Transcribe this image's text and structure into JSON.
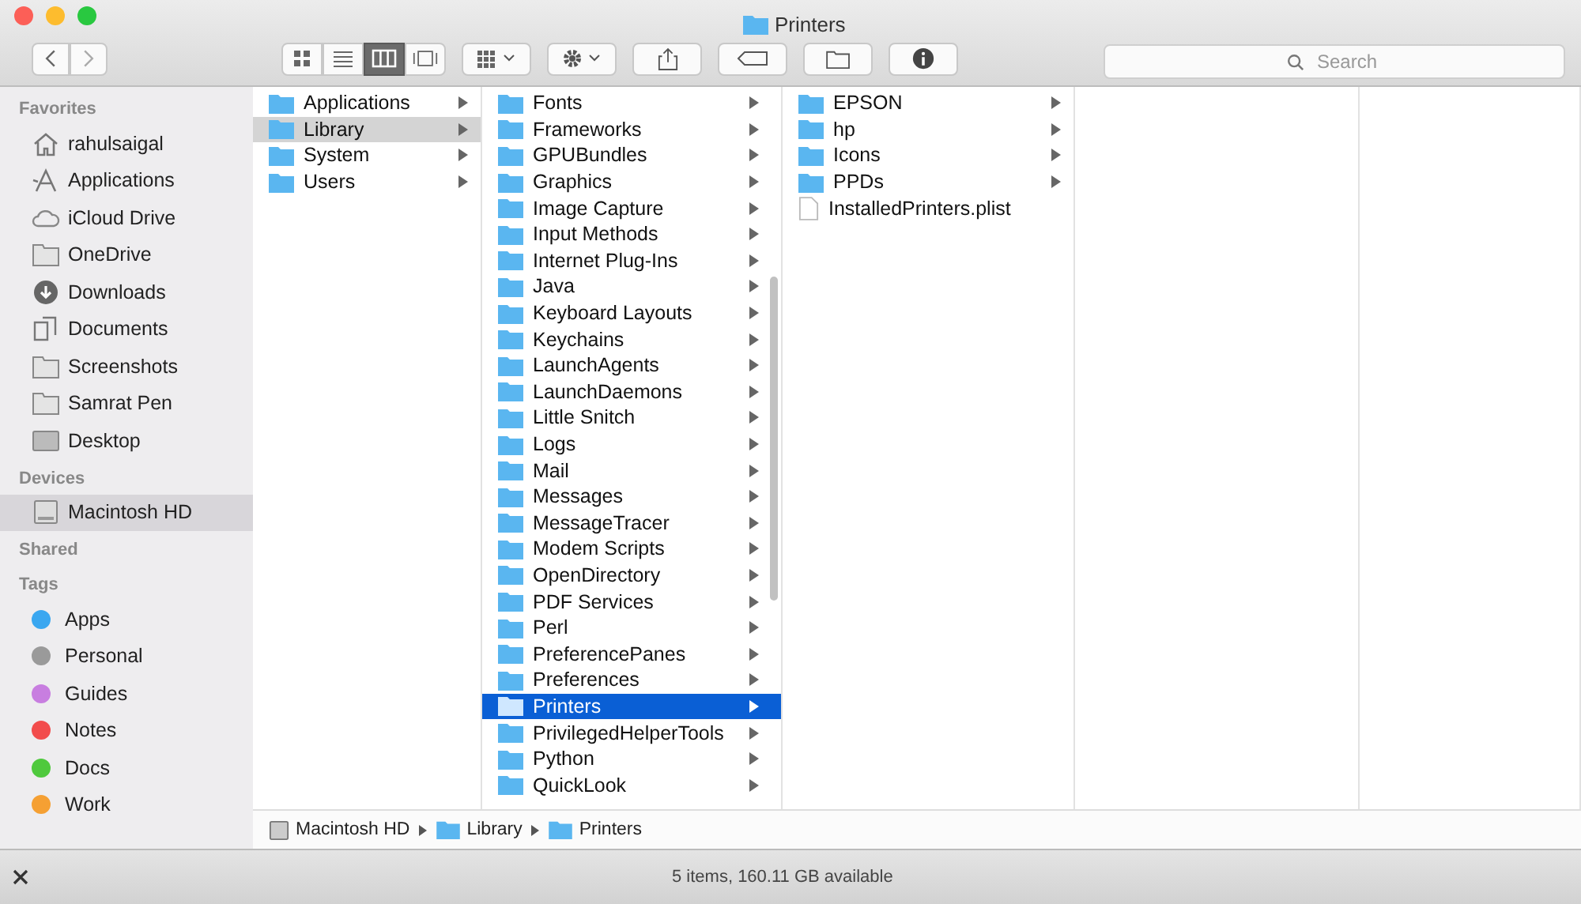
{
  "window": {
    "title": "Printers"
  },
  "toolbar": {
    "view_modes": [
      {
        "kind": "icons",
        "selected": false
      },
      {
        "kind": "list",
        "selected": false
      },
      {
        "kind": "columns",
        "selected": true
      },
      {
        "kind": "gallery",
        "selected": false
      }
    ],
    "search": {
      "placeholder": "Search"
    }
  },
  "sidebar": {
    "sections": [
      {
        "title": "Favorites",
        "items": [
          {
            "label": "rahulsaigal",
            "kind": "home",
            "selected": false
          },
          {
            "label": "Applications",
            "kind": "apps",
            "selected": false
          },
          {
            "label": "iCloud Drive",
            "kind": "cloud",
            "selected": false
          },
          {
            "label": "OneDrive",
            "kind": "folder",
            "selected": false
          },
          {
            "label": "Downloads",
            "kind": "download",
            "selected": false
          },
          {
            "label": "Documents",
            "kind": "docs",
            "selected": false
          },
          {
            "label": "Screenshots",
            "kind": "folder",
            "selected": false
          },
          {
            "label": "Samrat Pen",
            "kind": "folder",
            "selected": false
          },
          {
            "label": "Desktop",
            "kind": "desktop",
            "selected": false
          }
        ]
      },
      {
        "title": "Devices",
        "items": [
          {
            "label": "Macintosh HD",
            "kind": "disk",
            "selected": true
          }
        ]
      },
      {
        "title": "Shared"
      },
      {
        "title": "Tags",
        "items": [
          {
            "label": "Apps",
            "kind": "tag",
            "color": "#3aa7f0",
            "selected": false
          },
          {
            "label": "Personal",
            "kind": "tag",
            "color": "#9a9a9a",
            "selected": false
          },
          {
            "label": "Guides",
            "kind": "tag",
            "color": "#c87ee0",
            "selected": false
          },
          {
            "label": "Notes",
            "kind": "tag",
            "color": "#f24c4c",
            "selected": false
          },
          {
            "label": "Docs",
            "kind": "tag",
            "color": "#4fc93d",
            "selected": false
          },
          {
            "label": "Work",
            "kind": "tag",
            "color": "#f5a033",
            "selected": false
          }
        ]
      }
    ]
  },
  "columns": [
    {
      "kind": "list",
      "focused": false,
      "items": [
        {
          "name": "Applications",
          "kind": "folder",
          "selected": false
        },
        {
          "name": "Library",
          "kind": "folder",
          "selected": true
        },
        {
          "name": "System",
          "kind": "folder",
          "selected": false
        },
        {
          "name": "Users",
          "kind": "folder",
          "selected": false
        }
      ]
    },
    {
      "kind": "list",
      "focused": true,
      "items": [
        {
          "name": "Fonts",
          "kind": "folder",
          "selected": false
        },
        {
          "name": "Frameworks",
          "kind": "folder",
          "selected": false
        },
        {
          "name": "GPUBundles",
          "kind": "folder",
          "selected": false
        },
        {
          "name": "Graphics",
          "kind": "folder",
          "selected": false
        },
        {
          "name": "Image Capture",
          "kind": "folder",
          "selected": false
        },
        {
          "name": "Input Methods",
          "kind": "folder",
          "selected": false
        },
        {
          "name": "Internet Plug-Ins",
          "kind": "folder",
          "selected": false
        },
        {
          "name": "Java",
          "kind": "folder",
          "selected": false
        },
        {
          "name": "Keyboard Layouts",
          "kind": "folder",
          "selected": false
        },
        {
          "name": "Keychains",
          "kind": "folder",
          "selected": false
        },
        {
          "name": "LaunchAgents",
          "kind": "folder",
          "selected": false
        },
        {
          "name": "LaunchDaemons",
          "kind": "folder",
          "selected": false
        },
        {
          "name": "Little Snitch",
          "kind": "folder",
          "selected": false
        },
        {
          "name": "Logs",
          "kind": "folder",
          "selected": false
        },
        {
          "name": "Mail",
          "kind": "folder",
          "selected": false
        },
        {
          "name": "Messages",
          "kind": "folder",
          "selected": false
        },
        {
          "name": "MessageTracer",
          "kind": "folder",
          "selected": false
        },
        {
          "name": "Modem Scripts",
          "kind": "folder",
          "selected": false
        },
        {
          "name": "OpenDirectory",
          "kind": "folder",
          "selected": false
        },
        {
          "name": "PDF Services",
          "kind": "folder",
          "selected": false
        },
        {
          "name": "Perl",
          "kind": "folder",
          "selected": false
        },
        {
          "name": "PreferencePanes",
          "kind": "folder",
          "selected": false
        },
        {
          "name": "Preferences",
          "kind": "folder",
          "selected": false
        },
        {
          "name": "Printers",
          "kind": "folder",
          "selected": true
        },
        {
          "name": "PrivilegedHelperTools",
          "kind": "folder",
          "selected": false
        },
        {
          "name": "Python",
          "kind": "folder",
          "selected": false
        },
        {
          "name": "QuickLook",
          "kind": "folder",
          "selected": false
        }
      ]
    },
    {
      "kind": "list",
      "items": [
        {
          "name": "EPSON",
          "kind": "folder",
          "selected": false
        },
        {
          "name": "hp",
          "kind": "folder",
          "selected": false
        },
        {
          "name": "Icons",
          "kind": "folder",
          "selected": false
        },
        {
          "name": "PPDs",
          "kind": "folder",
          "selected": false
        },
        {
          "name": "InstalledPrinters.plist",
          "kind": "file",
          "selected": false
        }
      ]
    },
    {
      "kind": "empty"
    },
    {
      "kind": "empty"
    }
  ],
  "path_bar": [
    {
      "label": "Macintosh HD",
      "kind": "disk"
    },
    {
      "label": "Library",
      "kind": "folder"
    },
    {
      "label": "Printers",
      "kind": "folder"
    }
  ],
  "status_bar": "5 items, 160.11 GB available"
}
